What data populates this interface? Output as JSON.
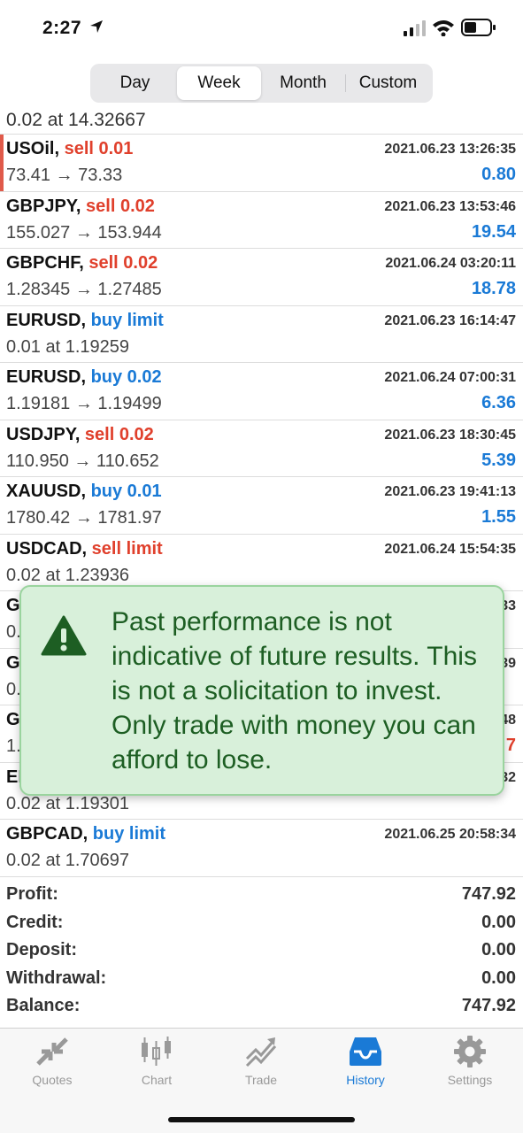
{
  "status_bar": {
    "time": "2:27"
  },
  "segmented": {
    "tabs": [
      "Day",
      "Week",
      "Month",
      "Custom"
    ],
    "active": "Week"
  },
  "partial_row": {
    "text": "0.02 at 14.32667"
  },
  "orders": [
    {
      "symbol": "USOil,",
      "action": " sell 0.01",
      "side": "sell",
      "prices": "73.41 → 73.33",
      "datetime": "2021.06.23 13:26:35",
      "pl": "0.80"
    },
    {
      "symbol": "GBPJPY,",
      "action": " sell 0.02",
      "side": "sell",
      "prices": "155.027 → 153.944",
      "datetime": "2021.06.23 13:53:46",
      "pl": "19.54"
    },
    {
      "symbol": "GBPCHF,",
      "action": " sell 0.02",
      "side": "sell",
      "prices": "1.28345 → 1.27485",
      "datetime": "2021.06.24 03:20:11",
      "pl": "18.78"
    },
    {
      "symbol": "EURUSD,",
      "action": " buy limit",
      "side": "buy",
      "prices": "0.01 at 1.19259",
      "datetime": "2021.06.23 16:14:47",
      "pl": ""
    },
    {
      "symbol": "EURUSD,",
      "action": " buy 0.02",
      "side": "buy",
      "prices": "1.19181 → 1.19499",
      "datetime": "2021.06.24 07:00:31",
      "pl": "6.36"
    },
    {
      "symbol": "USDJPY,",
      "action": " sell 0.02",
      "side": "sell",
      "prices": "110.950 → 110.652",
      "datetime": "2021.06.23 18:30:45",
      "pl": "5.39"
    },
    {
      "symbol": "XAUUSD,",
      "action": " buy 0.01",
      "side": "buy",
      "prices": "1780.42 → 1781.97",
      "datetime": "2021.06.23 19:41:13",
      "pl": "1.55"
    },
    {
      "symbol": "USDCAD,",
      "action": " sell limit",
      "side": "sell",
      "prices": "0.02 at 1.23936",
      "datetime": "2021.06.24 15:54:35",
      "pl": ""
    },
    {
      "symbol": "GI",
      "action": "",
      "side": "",
      "prices": "0.",
      "datetime": "33",
      "pl": ""
    },
    {
      "symbol": "GI",
      "action": "",
      "side": "",
      "prices": "0.",
      "datetime": "39",
      "pl": ""
    },
    {
      "symbol": "GI",
      "action": "",
      "side": "",
      "prices": "1.",
      "datetime": "48",
      "pl": "7"
    },
    {
      "symbol": "EI",
      "action": "",
      "side": "",
      "prices": "0.02 at 1.19301",
      "datetime": "32",
      "pl": ""
    },
    {
      "symbol": "GBPCAD,",
      "action": " buy limit",
      "side": "buy",
      "prices": "0.02 at 1.70697",
      "datetime": "2021.06.25 20:58:34",
      "pl": ""
    }
  ],
  "summary": [
    {
      "label": "Profit:",
      "value": "747.92"
    },
    {
      "label": "Credit:",
      "value": "0.00"
    },
    {
      "label": "Deposit:",
      "value": "0.00"
    },
    {
      "label": "Withdrawal:",
      "value": "0.00"
    },
    {
      "label": "Balance:",
      "value": "747.92"
    }
  ],
  "notice": {
    "text": "Past performance is not indicative of future results. This is not a solicitation to invest. Only trade with money you can afford to lose."
  },
  "tabbar": [
    {
      "label": "Quotes",
      "icon": "quotes-icon"
    },
    {
      "label": "Chart",
      "icon": "chart-icon"
    },
    {
      "label": "Trade",
      "icon": "trade-icon"
    },
    {
      "label": "History",
      "icon": "history-icon",
      "active": true
    },
    {
      "label": "Settings",
      "icon": "settings-icon"
    }
  ]
}
